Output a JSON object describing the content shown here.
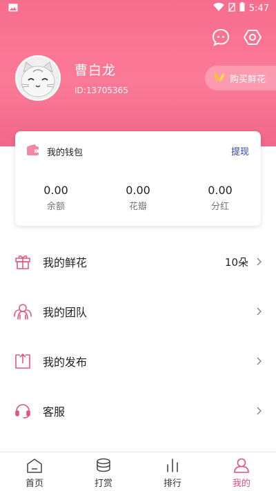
{
  "status_bar": {
    "time": "5:47"
  },
  "profile": {
    "name": "曹白龙",
    "id": "ID:13705365",
    "buy_flower_label": "购买鲜花"
  },
  "wallet": {
    "title": "我的钱包",
    "withdraw_label": "提现",
    "stats": [
      {
        "value": "0.00",
        "label": "余额"
      },
      {
        "value": "0.00",
        "label": "花瓣"
      },
      {
        "value": "0.00",
        "label": "分红"
      }
    ]
  },
  "menu": [
    {
      "label": "我的鲜花",
      "value": "10朵",
      "icon": "gift-icon"
    },
    {
      "label": "我的团队",
      "value": "",
      "icon": "team-icon"
    },
    {
      "label": "我的发布",
      "value": "",
      "icon": "publish-icon"
    },
    {
      "label": "客服",
      "value": "",
      "icon": "headset-icon"
    }
  ],
  "nav": [
    {
      "label": "首页",
      "icon": "home-icon",
      "active": false
    },
    {
      "label": "打赏",
      "icon": "coins-icon",
      "active": false
    },
    {
      "label": "排行",
      "icon": "ranking-icon",
      "active": false
    },
    {
      "label": "我的",
      "icon": "profile-icon",
      "active": true
    }
  ],
  "colors": {
    "header": "#f76d8e",
    "accent": "#e64b82",
    "menu_icon": "#e0567c",
    "withdraw": "#2c3fb0"
  }
}
